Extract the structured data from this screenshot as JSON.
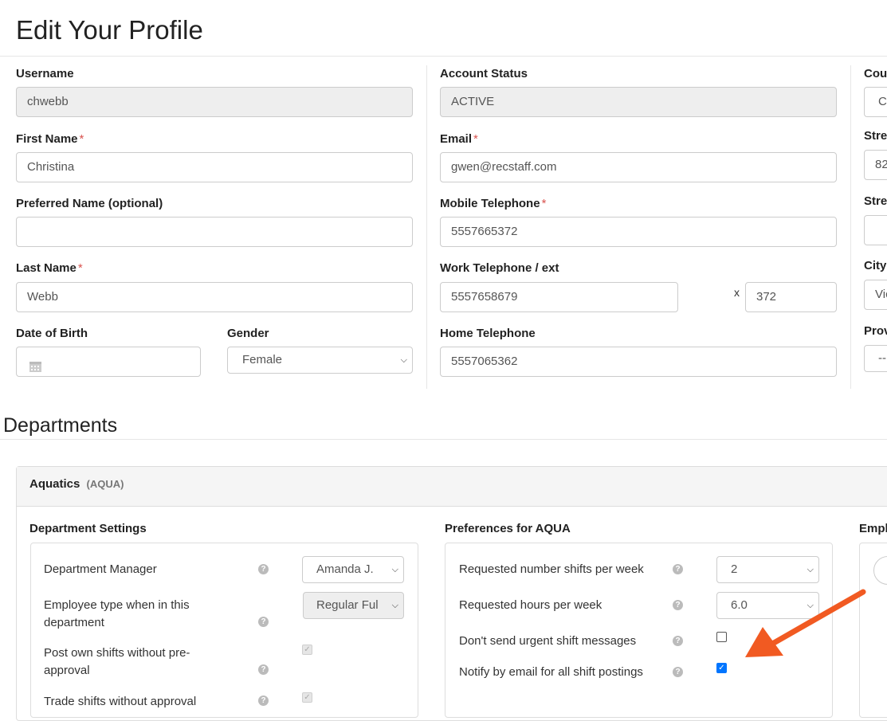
{
  "page": {
    "title": "Edit Your Profile"
  },
  "col1": {
    "username_label": "Username",
    "username_value": "chwebb",
    "first_name_label": "First Name",
    "first_name_value": "Christina",
    "preferred_name_label": "Preferred Name (optional)",
    "preferred_name_value": "",
    "last_name_label": "Last Name",
    "last_name_value": "Webb",
    "dob_label": "Date of Birth",
    "dob_value": "",
    "gender_label": "Gender",
    "gender_value": "Female",
    "required_mark": "*"
  },
  "col2": {
    "account_status_label": "Account Status",
    "account_status_value": "ACTIVE",
    "email_label": "Email",
    "email_value": "gwen@recstaff.com",
    "mobile_label": "Mobile Telephone",
    "mobile_value": "5557665372",
    "work_label": "Work Telephone / ext",
    "work_value": "5557658679",
    "ext_prefix": "x",
    "ext_value": "372",
    "home_label": "Home Telephone",
    "home_value": "5557065362"
  },
  "col3": {
    "country_label": "Cou",
    "country_value": "C",
    "street1_label": "Stre",
    "street1_value": "82",
    "street2_label": "Stre",
    "street2_value": "",
    "city_label": "City",
    "city_value": "Vic",
    "province_label": "Prov",
    "province_value": "--"
  },
  "departments": {
    "heading": "Departments",
    "name": "Aquatics",
    "code": "(AQUA)",
    "settings_title": "Department Settings",
    "settings": [
      {
        "label": "Department Manager",
        "value": "Amanda J."
      },
      {
        "label": "Employee type when in this department",
        "value": "Regular Ful"
      },
      {
        "label": "Post own shifts without pre-approval",
        "checked": true
      },
      {
        "label": "Trade shifts without approval",
        "checked": true
      }
    ],
    "prefs_title": "Preferences for AQUA",
    "prefs": [
      {
        "label": "Requested number shifts per week",
        "value": "2"
      },
      {
        "label": "Requested hours per week",
        "value": "6.0"
      },
      {
        "label": "Don't send urgent shift messages",
        "checked": false
      },
      {
        "label": "Notify by email for all shift postings",
        "checked": true
      }
    ],
    "third_title": "Empl"
  },
  "colors": {
    "arrow": "#f15a22",
    "checkbox_on": "#0075ff",
    "required": "#d9534f"
  },
  "icons": {
    "help": "question-circle-icon",
    "calendar": "calendar-icon",
    "chevron": "chevron-down-icon",
    "arrow": "annotation-arrow-icon"
  }
}
